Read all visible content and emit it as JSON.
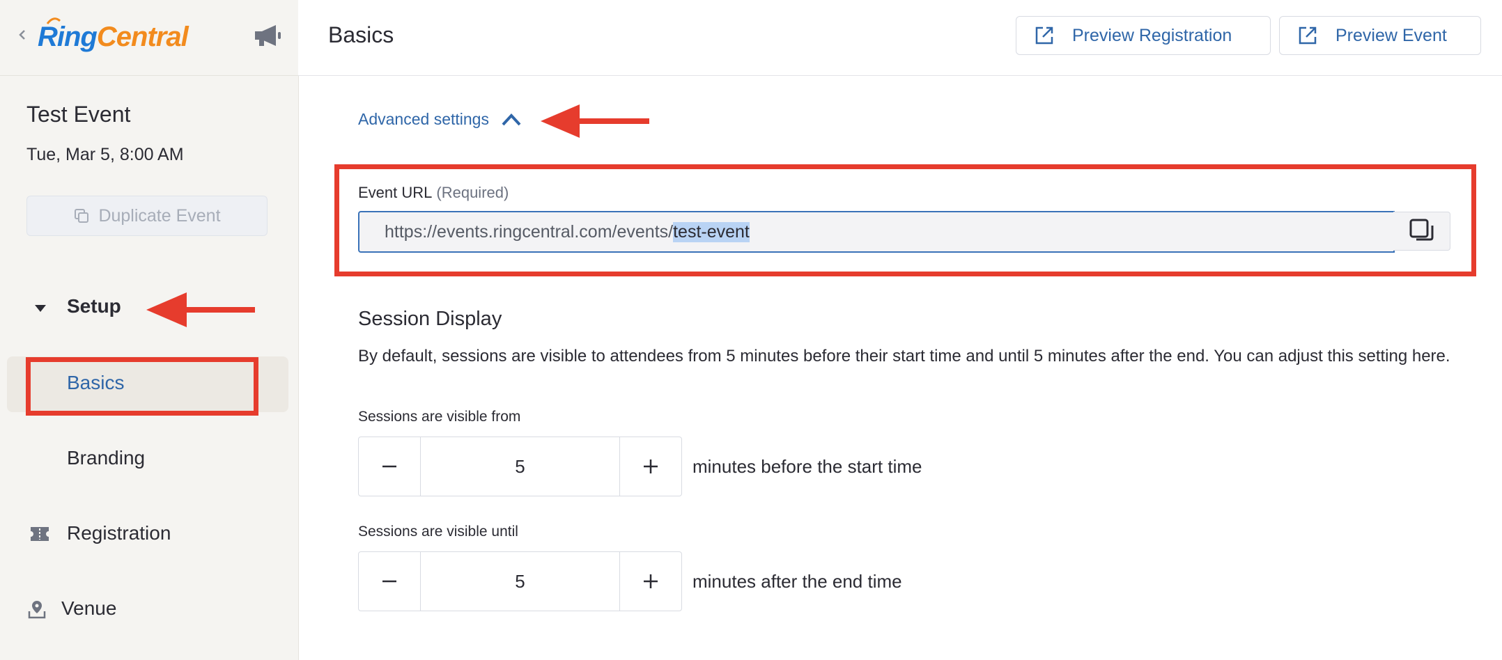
{
  "sidebar": {
    "logo": {
      "part1": "Ring",
      "part2": "Central"
    },
    "event_title": "Test Event",
    "event_date": "Tue, Mar 5, 8:00 AM",
    "duplicate_label": "Duplicate Event",
    "nav": {
      "section": "Setup",
      "items": [
        {
          "label": "Basics",
          "active": true
        },
        {
          "label": "Branding"
        },
        {
          "label": "Registration",
          "icon": "ticket-icon"
        },
        {
          "label": "Venue",
          "icon": "location-pin-icon"
        }
      ]
    }
  },
  "header": {
    "title": "Basics",
    "preview_registration": "Preview Registration",
    "preview_event": "Preview Event"
  },
  "main": {
    "advanced_settings": "Advanced settings",
    "event_url": {
      "label": "Event URL",
      "required": "(Required)",
      "prefix": "https://events.ringcentral.com/events/",
      "slug": "test-event"
    },
    "session_display": {
      "title": "Session Display",
      "description": "By default, sessions are visible to attendees from 5 minutes before their start time and until 5 minutes after the end. You can adjust this setting here.",
      "from": {
        "label": "Sessions are visible from",
        "value": "5",
        "suffix": "minutes before the start time"
      },
      "until": {
        "label": "Sessions are visible until",
        "value": "5",
        "suffix": "minutes after the end time"
      }
    }
  },
  "colors": {
    "accent": "#2f66a8",
    "annotation": "#e63c2d",
    "sidebar_bg": "#f5f4f1",
    "brand_blue": "#1f7ad6",
    "brand_orange": "#f28b1e"
  }
}
